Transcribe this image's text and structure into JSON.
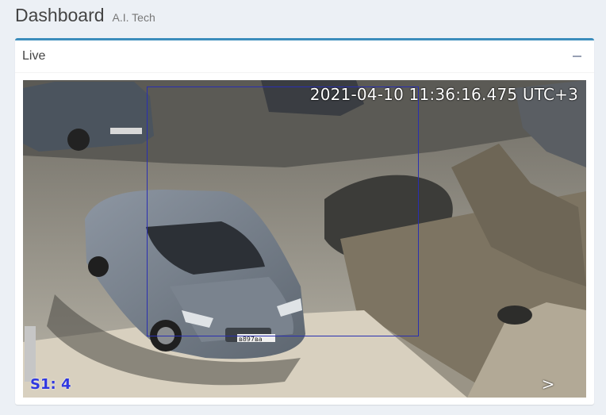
{
  "header": {
    "title": "Dashboard",
    "subtitle": "A.I. Tech"
  },
  "panel": {
    "title": "Live",
    "collapse_icon": "minus-icon",
    "accent_color": "#3c8dbc"
  },
  "video": {
    "timestamp": "2021-04-10 11:36:16.475 UTC+3",
    "stream_label": "S1: 4",
    "next_label": ">",
    "detection_color": "#2a2fb0",
    "plate_text": "в897ва"
  }
}
